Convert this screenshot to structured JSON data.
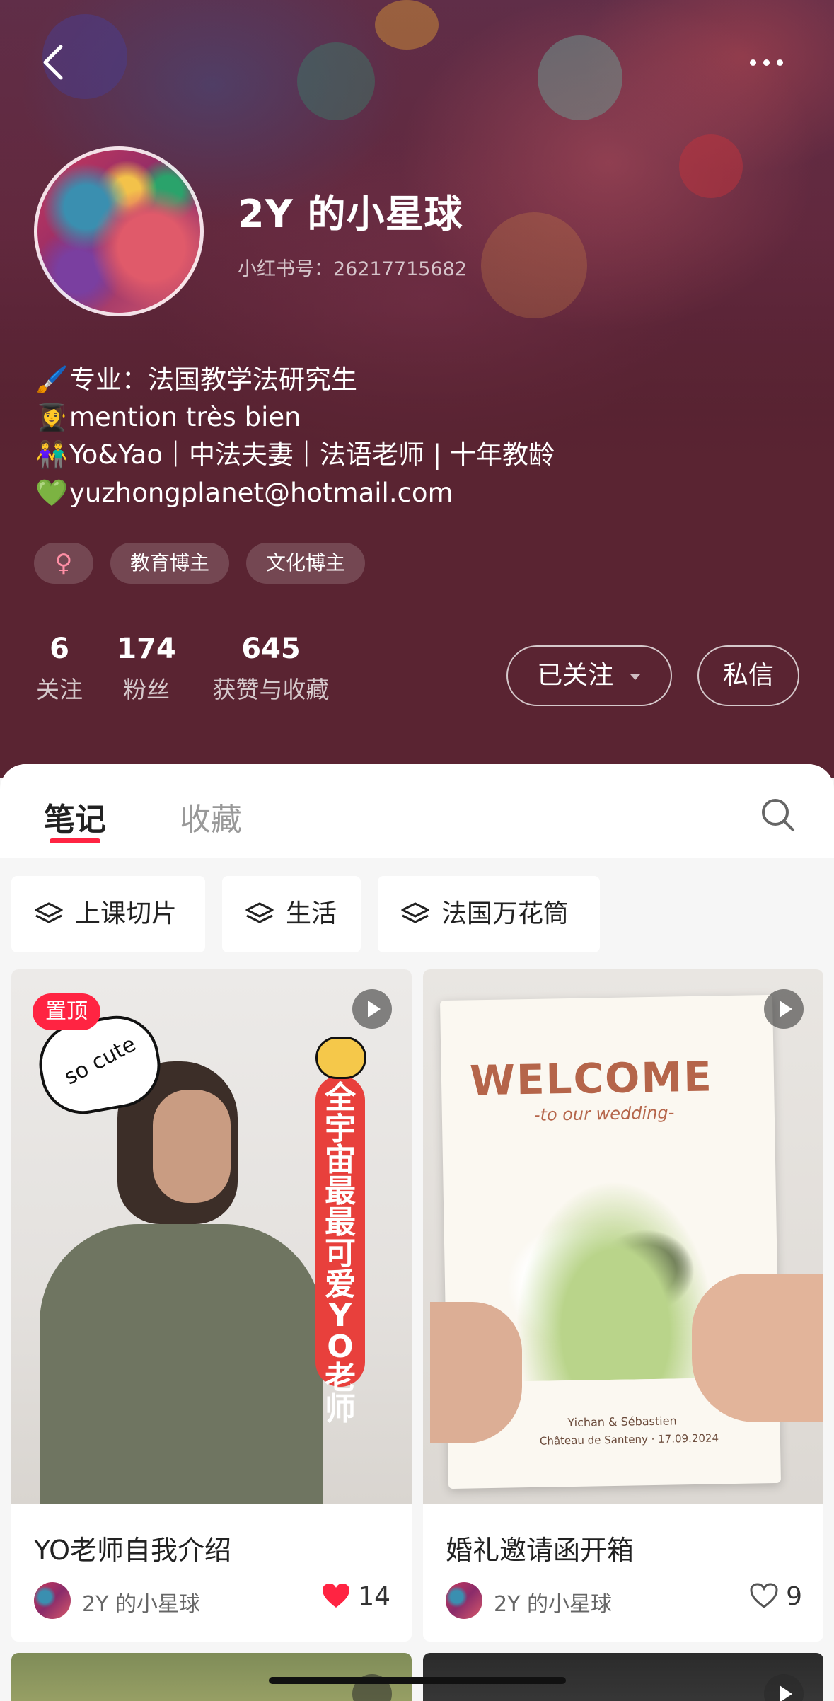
{
  "profile": {
    "name": "2Y 的小星球",
    "red_id": "小红书号：26217715682",
    "bio": [
      {
        "icon": "🖌️",
        "text": "专业：法国教学法研究生"
      },
      {
        "icon": "👩‍🎓",
        "text": "mention très bien"
      },
      {
        "icon": "👫",
        "text": "Yo&Yao｜中法夫妻｜法语老师 | 十年教龄"
      },
      {
        "icon": "💚",
        "text": "yuzhongplanet@hotmail.com"
      }
    ],
    "tags": [
      "♀",
      "教育博主",
      "文化博主"
    ],
    "stats": [
      {
        "value": "6",
        "label": "关注"
      },
      {
        "value": "174",
        "label": "粉丝"
      },
      {
        "value": "645",
        "label": "获赞与收藏"
      }
    ],
    "follow_label": "已关注",
    "message_label": "私信"
  },
  "tabs": {
    "notes": "笔记",
    "collections": "收藏"
  },
  "collections_chips": [
    "上课切片",
    "生活",
    "法国万花筒"
  ],
  "notes": [
    {
      "title": "YO老师自我介绍",
      "author": "2Y 的小星球",
      "likes": "14",
      "liked": true,
      "pinned_label": "置顶",
      "cover_text": {
        "bubble": "so cute",
        "vertical": "全宇宙最最可爱YO老师"
      }
    },
    {
      "title": "婚礼邀请函开箱",
      "author": "2Y 的小星球",
      "likes": "9",
      "liked": false,
      "cover_text": {
        "welcome": "WELCOME",
        "sub": "-to our wedding-",
        "names": "Yichan & Sébastien",
        "place": "Château de Santeny · 17.09.2024"
      }
    }
  ],
  "colors": {
    "accent": "#ff2442",
    "header_bg": "#5a2432"
  }
}
